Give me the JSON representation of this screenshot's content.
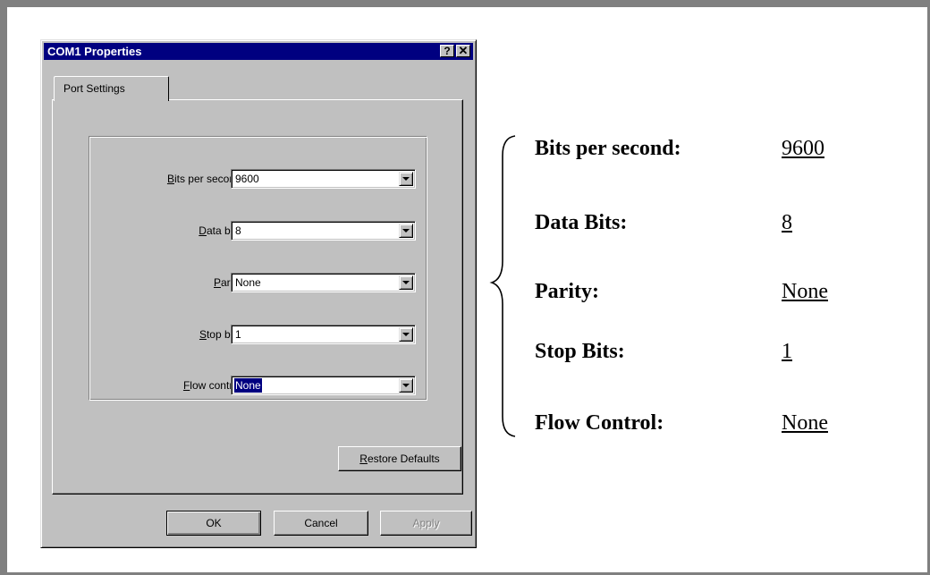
{
  "dialog": {
    "title": "COM1 Properties",
    "help_button": "?",
    "close_button": "✕",
    "tab_label": "Port Settings",
    "fields": [
      {
        "label_mnemonic": "B",
        "label_rest": "its per second:",
        "value": "9600",
        "selected": false
      },
      {
        "label_mnemonic": "D",
        "label_rest": "ata bits:",
        "value": "8",
        "selected": false
      },
      {
        "label_mnemonic": "P",
        "label_rest": "arity:",
        "value": "None",
        "selected": false
      },
      {
        "label_mnemonic": "S",
        "label_rest": "top bits:",
        "value": "1",
        "selected": false
      },
      {
        "label_mnemonic": "F",
        "label_rest": "low control:",
        "value": "None",
        "selected": true
      }
    ],
    "restore_mnemonic": "R",
    "restore_rest": "estore Defaults",
    "ok_label": "OK",
    "cancel_label": "Cancel",
    "apply_label": "Apply"
  },
  "summary": {
    "rows": [
      {
        "key": "Bits per second:",
        "value": "9600"
      },
      {
        "key": "Data Bits:",
        "value": "8"
      },
      {
        "key": "Parity:",
        "value": "None"
      },
      {
        "key": "Stop Bits:",
        "value": "1"
      },
      {
        "key": "Flow Control:",
        "value": "None"
      }
    ]
  }
}
